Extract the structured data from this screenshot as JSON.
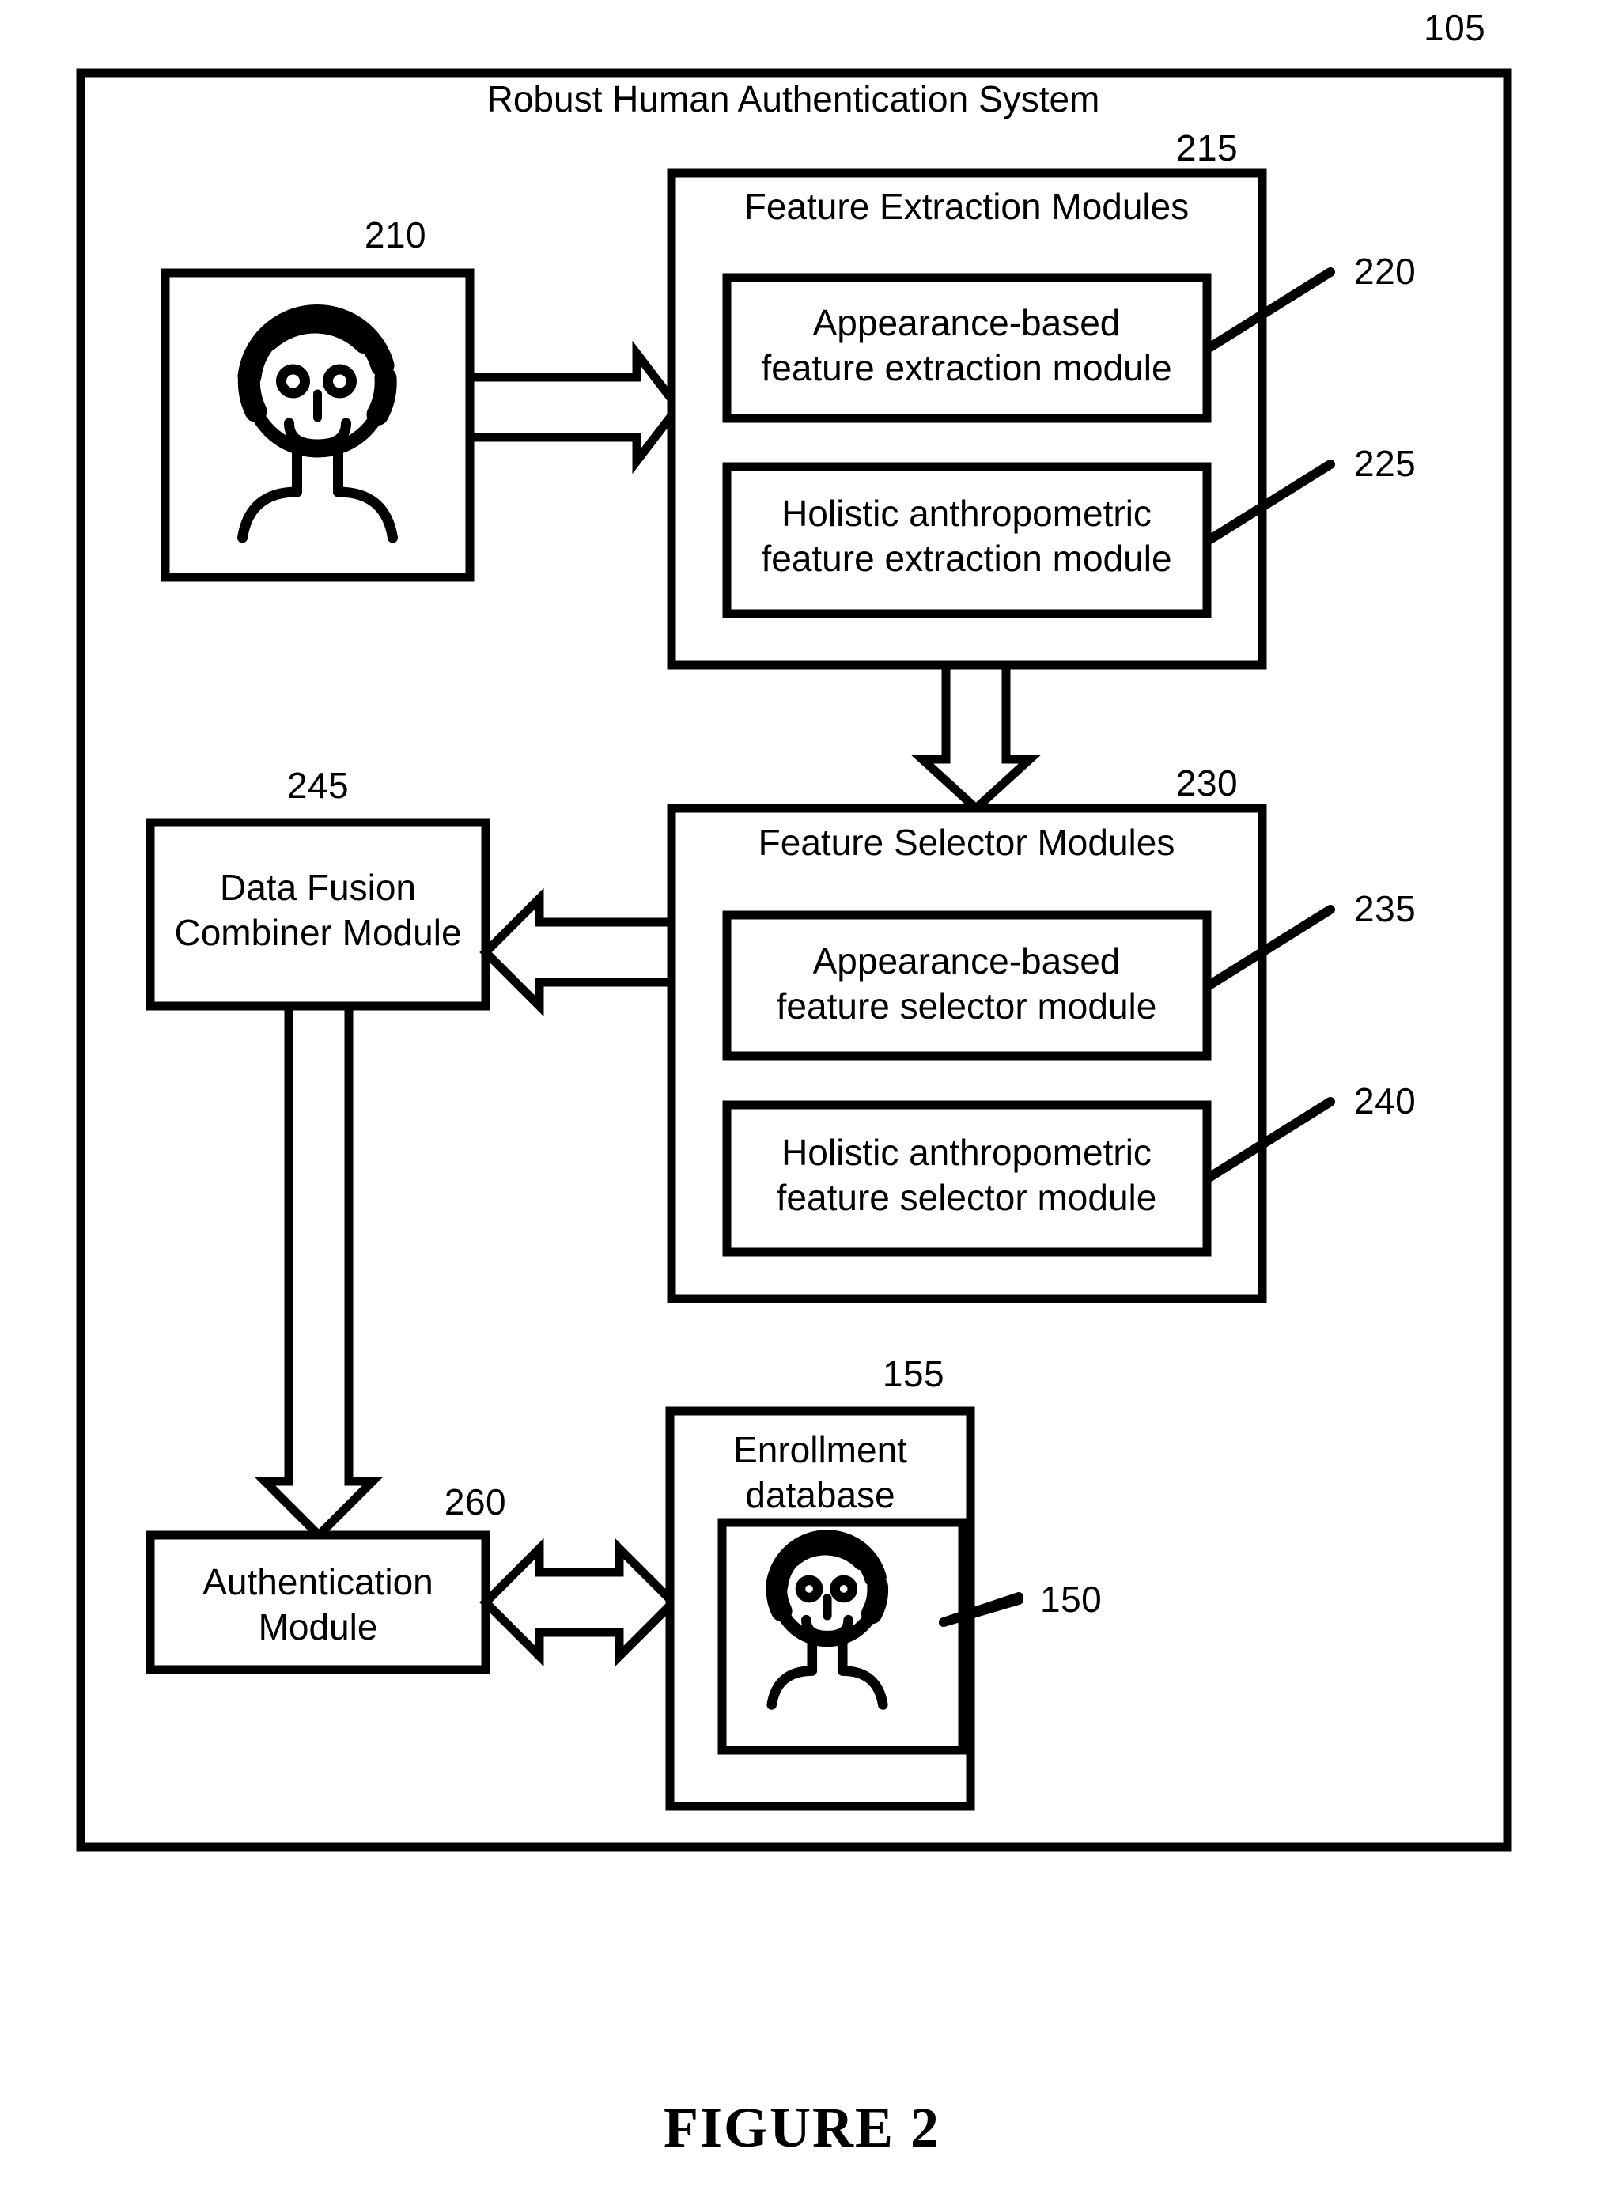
{
  "figure": {
    "caption": "FIGURE 2",
    "outer_ref": "105"
  },
  "system": {
    "title": "Robust Human Authentication System"
  },
  "refs": {
    "r105": "105",
    "r210": "210",
    "r215": "215",
    "r220": "220",
    "r225": "225",
    "r230": "230",
    "r235": "235",
    "r240": "240",
    "r245": "245",
    "r155": "155",
    "r150": "150",
    "r260": "260"
  },
  "blocks": {
    "input_image": {
      "ref": "210",
      "icon": "person-portrait-icon"
    },
    "feature_extraction": {
      "title": "Feature Extraction Modules",
      "ref": "215",
      "children": [
        {
          "line1": "Appearance-based",
          "line2": "feature extraction module",
          "ref": "220"
        },
        {
          "line1": "Holistic anthropometric",
          "line2": "feature extraction module",
          "ref": "225"
        }
      ]
    },
    "feature_selector": {
      "title": "Feature Selector Modules",
      "ref": "230",
      "children": [
        {
          "line1": "Appearance-based",
          "line2": "feature selector module",
          "ref": "235"
        },
        {
          "line1": "Holistic anthropometric",
          "line2": "feature selector module",
          "ref": "240"
        }
      ]
    },
    "data_fusion": {
      "line1": "Data Fusion",
      "line2": "Combiner Module",
      "ref": "245"
    },
    "authentication": {
      "line1": "Authentication",
      "line2": "Module",
      "ref": "260"
    },
    "enrollment_db": {
      "line1": "Enrollment",
      "line2": "database",
      "ref": "155",
      "photo_ref": "150",
      "icon": "person-portrait-icon"
    }
  },
  "colors": {
    "stroke": "#000000",
    "fill": "#ffffff"
  }
}
